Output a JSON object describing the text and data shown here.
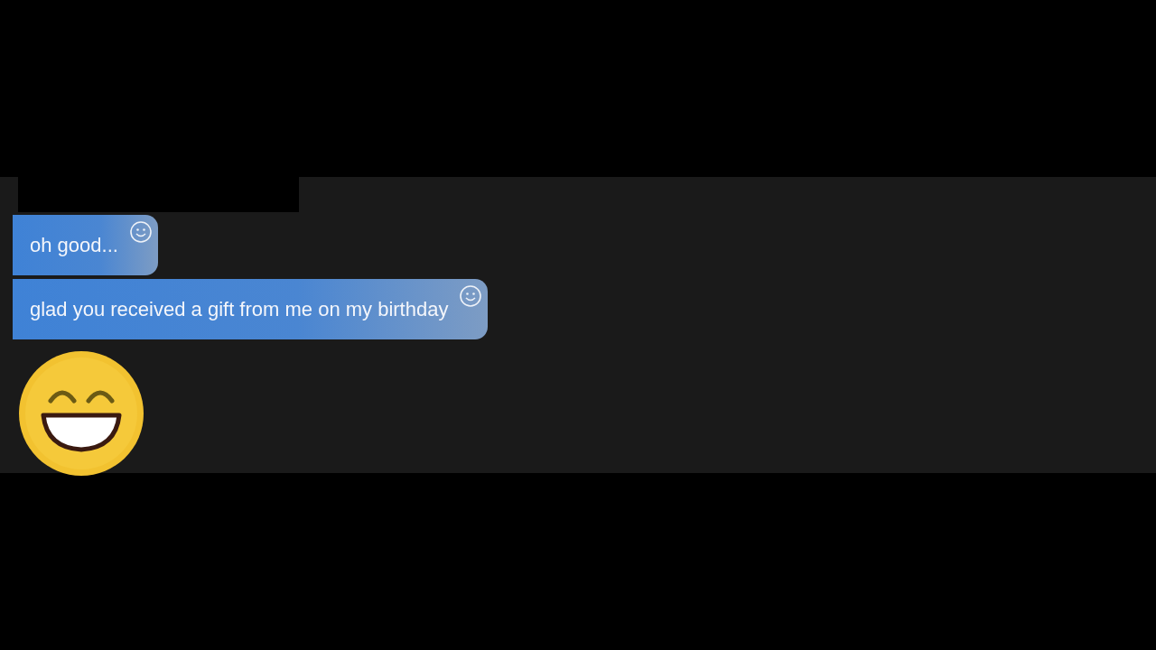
{
  "messages": [
    {
      "kind": "text",
      "text": "oh good..."
    },
    {
      "kind": "text",
      "text": "glad you received a gift from me on my birthday"
    },
    {
      "kind": "emoji"
    }
  ]
}
